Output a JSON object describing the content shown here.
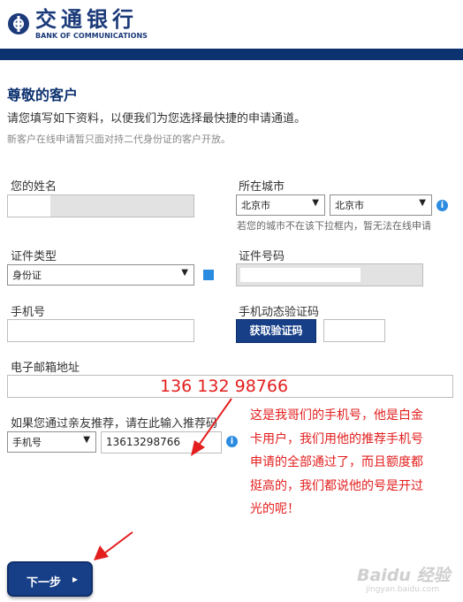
{
  "brand": {
    "name_cn": "交通银行",
    "name_en": "BANK OF COMMUNICATIONS",
    "color": "#1b3a7a"
  },
  "page": {
    "title": "尊敬的客户",
    "intro": "请您填写如下资料，以便我们为您选择最快捷的申请通道。",
    "note": "新客户在线申请暂只面对持二代身份证的客户开放。"
  },
  "form": {
    "name_label": "您的姓名",
    "city_label": "所在城市",
    "province_value": "北京市",
    "city_value": "北京市",
    "city_hint": "若您的城市不在该下拉框内，暂无法在线申请",
    "id_type_label": "证件类型",
    "id_type_value": "身份证",
    "id_number_label": "证件号码",
    "mobile_label": "手机号",
    "sms_code_label": "手机动态验证码",
    "get_code_button": "获取验证码",
    "email_label": "电子邮箱地址",
    "referral_label": "如果您通过亲友推荐，请在此输入推荐码",
    "referral_type_value": "手机号",
    "referral_code_value": "13613298766",
    "next_button": "下一步",
    "next_arrow": "▸"
  },
  "annotation": {
    "phone_text": "136 132 98766",
    "lines": [
      "这是我哥们的手机号，他是白金",
      "卡用户，我们用他的推荐手机号",
      "申请的全部通过了，而且额度都",
      "挺高的，我们都说他的号是开过",
      "光的呢！"
    ],
    "color": "#e31e1e"
  },
  "watermark": {
    "brand": "Baidu 经验",
    "url": "jingyan.baidu.com"
  },
  "icons": {
    "info": "info-icon",
    "dropdown": "chevron-down-icon",
    "logo": "bank-logo-icon"
  }
}
